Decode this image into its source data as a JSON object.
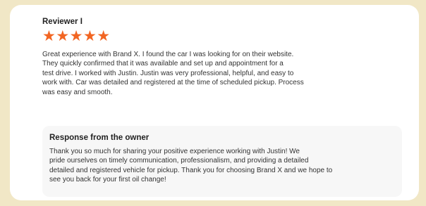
{
  "review": {
    "reviewer": "Reviewer I",
    "stars": "★★★★★",
    "rating": 5,
    "star_color": "#f26522",
    "text": "Great experience with Brand X. I found the car I was looking for on their website.\nThey quickly confirmed that it was available and set up and appointment for a\ntest drive. I worked with Justin. Justin was very professional, helpful, and easy to\nwork with. Car was detailed and registered at the time of scheduled pickup. Process\nwas easy and smooth."
  },
  "response": {
    "title": "Response from the owner",
    "text": "Thank you so much for sharing your positive experience working with Justin! We\npride ourselves on timely communication, professionalism, and providing a detailed\ndetailed and registered vehicle for pickup. Thank you for choosing Brand X and we hope to\nsee you back for your first oil change!"
  }
}
